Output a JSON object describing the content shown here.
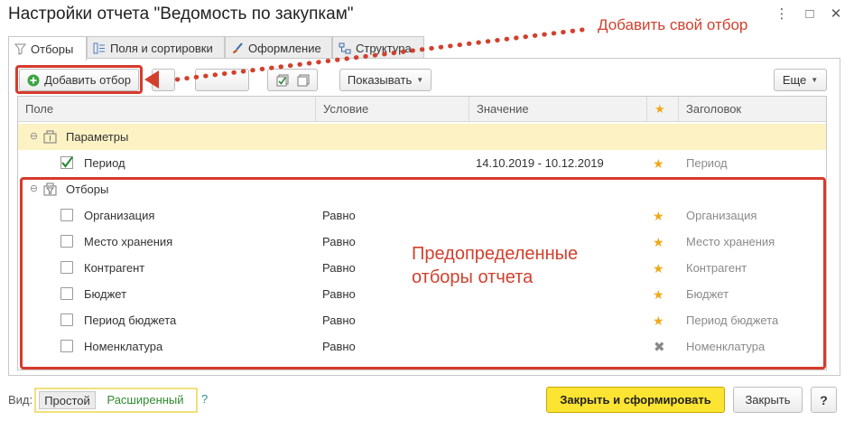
{
  "window": {
    "title": "Настройки отчета \"Ведомость по закупкам\"",
    "more_icon": "⋮",
    "maximize_icon": "□",
    "close_icon": "✕"
  },
  "annotations": {
    "add_own_filter": "Добавить свой отбор",
    "predefined_line1": "Предопределенные",
    "predefined_line2": "отборы отчета",
    "color": "#d2402e"
  },
  "tabs": [
    {
      "label": "Отборы",
      "icon": "funnel-icon",
      "active": true
    },
    {
      "label": "Поля и сортировки",
      "icon": "fields-icon",
      "active": false
    },
    {
      "label": "Оформление",
      "icon": "brush-icon",
      "active": false
    },
    {
      "label": "Структура",
      "icon": "structure-icon",
      "active": false
    }
  ],
  "toolbar": {
    "add_filter_label": "Добавить отбор",
    "show_label": "Показывать",
    "more_label": "Еще"
  },
  "grid": {
    "columns": {
      "field": "Поле",
      "condition": "Условие",
      "value": "Значение",
      "star": "★",
      "header": "Заголовок"
    },
    "params_group": {
      "label": "Параметры"
    },
    "period_row": {
      "field": "Период",
      "value": "14.10.2019 - 10.12.2019",
      "header": "Период",
      "checked": true
    },
    "filters_group": {
      "label": "Отборы"
    },
    "filter_rows": [
      {
        "field": "Организация",
        "condition": "Равно",
        "header": "Организация",
        "mark": "star",
        "checked": false
      },
      {
        "field": "Место хранения",
        "condition": "Равно",
        "header": "Место хранения",
        "mark": "star",
        "checked": false
      },
      {
        "field": "Контрагент",
        "condition": "Равно",
        "header": "Контрагент",
        "mark": "star",
        "checked": false
      },
      {
        "field": "Бюджет",
        "condition": "Равно",
        "header": "Бюджет",
        "mark": "star",
        "checked": false
      },
      {
        "field": "Период бюджета",
        "condition": "Равно",
        "header": "Период бюджета",
        "mark": "star",
        "checked": false
      },
      {
        "field": "Номенклатура",
        "condition": "Равно",
        "header": "Номенклатура",
        "mark": "cross",
        "checked": false
      }
    ]
  },
  "footer": {
    "view_label": "Вид:",
    "mode_simple": "Простой",
    "mode_extended": "Расширенный",
    "help_q": "?",
    "primary_button": "Закрыть и сформировать",
    "close_button": "Закрыть",
    "help_button": "?"
  },
  "colors": {
    "accent_red": "#d73a2c",
    "primary_yellow": "#fce433",
    "group_highlight": "#fcf2c4",
    "star": "#f0a81a"
  }
}
